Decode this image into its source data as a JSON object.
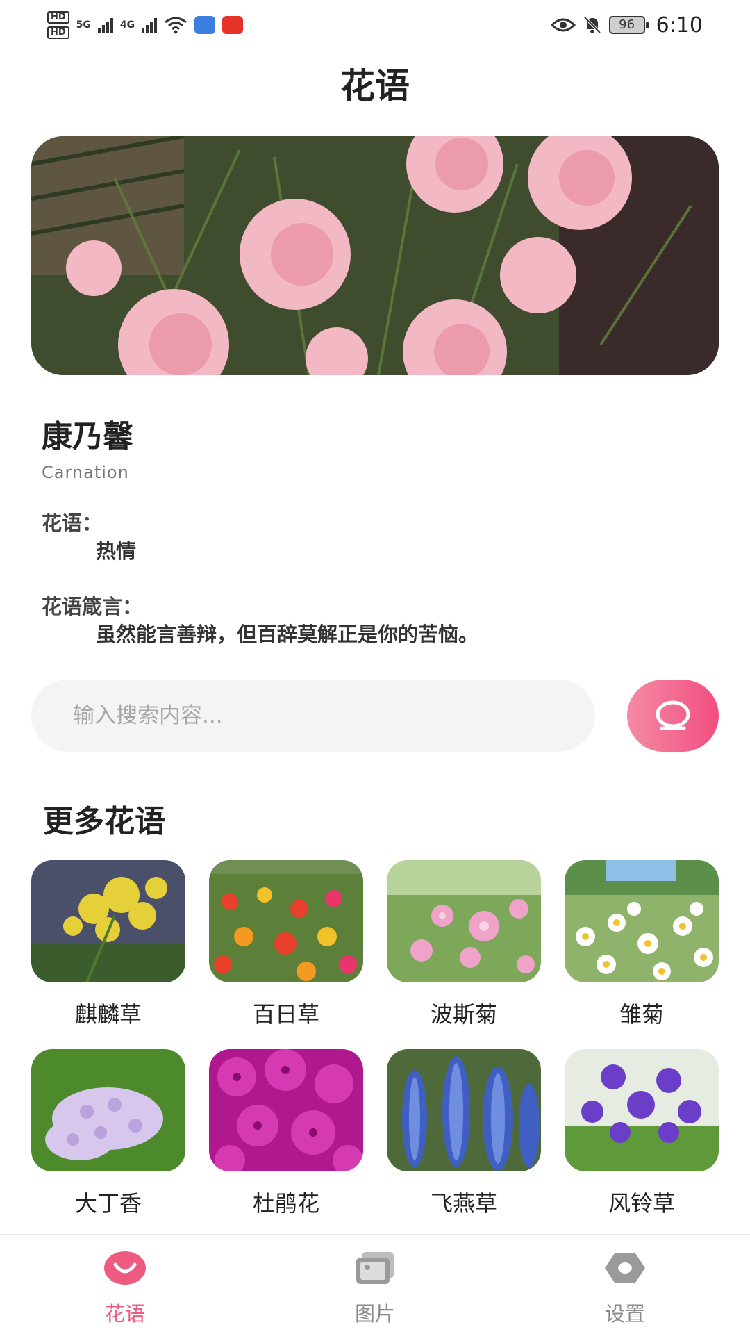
{
  "status_bar": {
    "time": "6:10",
    "battery": "96",
    "sim1": "HD",
    "sim2": "HD",
    "net1": "5G",
    "net2": "4G"
  },
  "header": {
    "title": "花语"
  },
  "hero": {
    "image": "carnation-photo"
  },
  "flower": {
    "name": "康乃馨",
    "english": "Carnation",
    "meaning_label": "花语：",
    "meaning": "热情",
    "motto_label": "花语箴言：",
    "motto": "虽然能言善辩，但百辞莫解正是你的苦恼。"
  },
  "search": {
    "placeholder": "输入搜索内容...",
    "icon": "search-icon",
    "button_colors": [
      "#f58aa6",
      "#f14e7f"
    ]
  },
  "more": {
    "title": "更多花语",
    "items": [
      {
        "label": "麒麟草"
      },
      {
        "label": "百日草"
      },
      {
        "label": "波斯菊"
      },
      {
        "label": "雏菊"
      },
      {
        "label": "大丁香"
      },
      {
        "label": "杜鹃花"
      },
      {
        "label": "飞燕草"
      },
      {
        "label": "风铃草"
      }
    ]
  },
  "tabs": [
    {
      "label": "花语",
      "icon": "smile-icon",
      "active": true
    },
    {
      "label": "图片",
      "icon": "photos-icon",
      "active": false
    },
    {
      "label": "设置",
      "icon": "settings-icon",
      "active": false
    }
  ],
  "colors": {
    "accent": "#ef5b80",
    "inactive": "#8a8a8a",
    "search_bg": "#f4f4f4"
  }
}
